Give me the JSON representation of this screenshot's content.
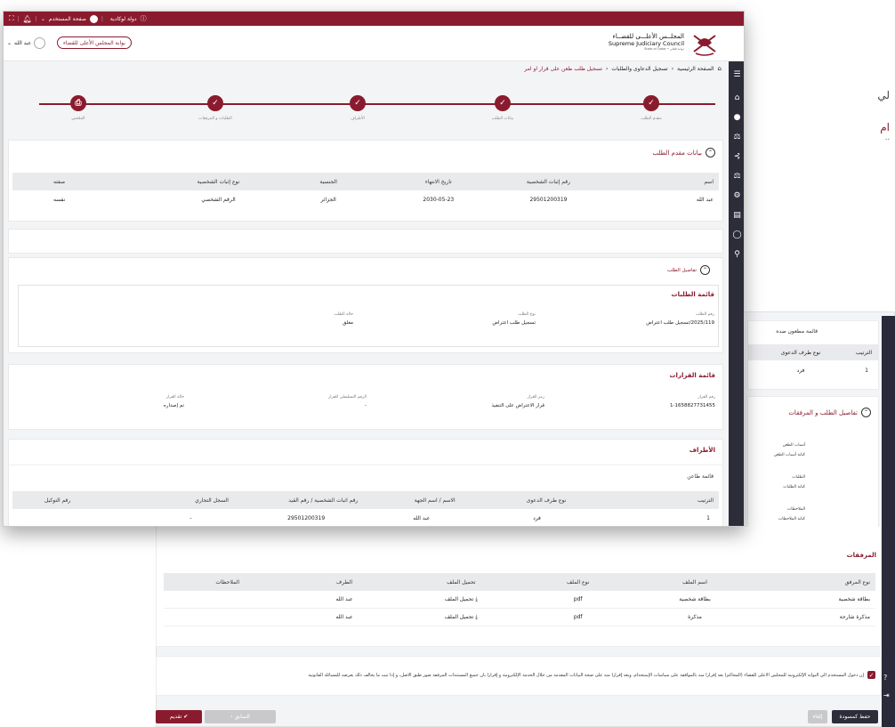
{
  "bg_partial": {
    "line1": "لي",
    "line2": "ام",
    "line3": ".."
  },
  "bg_defendants": {
    "title": "قائمة مطعون ضده",
    "headers": [
      "الترتيب",
      "نوع طرف الدعوى"
    ],
    "row": [
      "1",
      "فرد"
    ]
  },
  "bg_details": {
    "title": "تفاصيل الطلب و المرفقات",
    "fields": [
      {
        "label": "أسباب الطعن",
        "value": "كتابة أسباب الطعن"
      },
      {
        "label": "الطلبات",
        "value": "كتابة الطلبات"
      },
      {
        "label": "الملاحظات",
        "value": "كتابة الملاحظات"
      }
    ]
  },
  "attachments": {
    "title": "المرفقات",
    "headers": [
      "نوع المرفق",
      "اسم الملف",
      "نوع الملف",
      "تحميل الملف",
      "الطرف",
      "الملاحظات"
    ],
    "rows": [
      [
        "بطاقة شخصية",
        "بطاقة شخصية",
        "pdf",
        "تحميل الملف",
        "عبد الله",
        ""
      ],
      [
        "مذكرة شارحة",
        "مذكرة",
        "pdf",
        "تحميل الملف",
        "عبد الله",
        ""
      ]
    ]
  },
  "declaration": "إن دخول المستخدم الى البوابة الإلكترونية للمجلس الأعلى للقضاء (المحاكم) يعد إقراراً منه بالموافقة على سياسات الإستخدام، ويعد إقراراً منه على صحة البيانات المقدمة من خلال الخدمة الإلكترونية و إقراراً بأن جميع المستندات المرفقة صور طبق الأصل، و إذا ثبت ما يخالف ذلك يعرضه للمسائلة القانونية",
  "bottom_buttons": {
    "submit": "تقديم",
    "previous": "السابق",
    "save_draft": "حفظ كمسودة",
    "cancel": "إلغاء"
  },
  "topbar": {
    "user": "صفحة المستخدم",
    "site": "دولة لوكادية",
    "info": "ⓘ"
  },
  "header": {
    "portal_button": "بوابة المجلس الأعلى للقضاء",
    "user_name": "عبد الله",
    "council_ar": "المجلــس الأعلـــى للقضــاء",
    "council_en": "Supreme Judiciary Council",
    "state": "State of Qatar • دولـة قطـر"
  },
  "breadcrumb": {
    "home": "الصفحة الرئيسية",
    "section": "تسجيل الدعاوى والطلبات",
    "current": "تسجيل طلب طعن على قرار او امر"
  },
  "steps": [
    "مقدم الطلب",
    "بيانات الطلب",
    "الأطراف",
    "الطلبات و المرفقات",
    "الملخص"
  ],
  "applicant": {
    "title": "بيانات مقدم الطلب",
    "headers": [
      "اسم",
      "رقم إثبات الشخصية",
      "تاريخ الانتهاء",
      "الجنسية",
      "نوع إثبات الشخصية",
      "صفته"
    ],
    "row": [
      "عبد الله",
      "29501200319",
      "2030-05-23",
      "الجزائر",
      "الرقم الشخصي",
      "نفسه"
    ]
  },
  "request_details": {
    "title": "تفاصيل الطلب",
    "list_title": "قائمة الطلبات",
    "fields": [
      {
        "label": "رقم الطلب",
        "value": "2025/119/تسجيل طلب اعتراض"
      },
      {
        "label": "نوع الطلب",
        "value": "تسجيل طلب اعتراض"
      },
      {
        "label": "حالة الطلب",
        "value": "مغلق"
      }
    ]
  },
  "decisions": {
    "title": "قائمة القرارات",
    "fields": [
      {
        "label": "رقم القرار",
        "value": "1-1658827731455"
      },
      {
        "label": "رمز القرار",
        "value": "قرار الاعتراض على التنفيذ"
      },
      {
        "label": "الرقم التسلسلي للقرار",
        "value": "-"
      },
      {
        "label": "حالة القرار",
        "value": "تم إصداره"
      }
    ]
  },
  "parties": {
    "title": "الأطراف",
    "sub_title": "قائمة طاعن",
    "headers": [
      "الترتيب",
      "نوع طرف الدعوى",
      "الاسم / اسم الجهة",
      "رقم اثبات الشخصية / رقم القيد",
      "السجل التجاري",
      "رقم التوكيل"
    ],
    "row": [
      "1",
      "فرد",
      "عبد الله",
      "29501200319",
      "-",
      ""
    ]
  }
}
